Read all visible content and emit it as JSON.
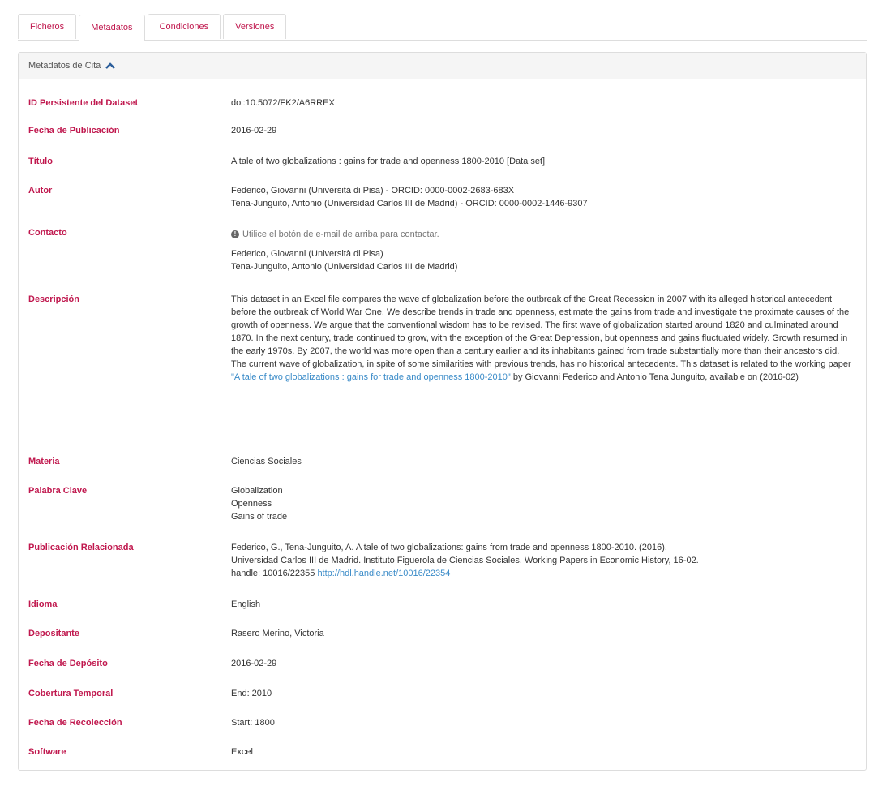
{
  "tabs": [
    {
      "label": "Ficheros"
    },
    {
      "label": "Metadatos",
      "active": true
    },
    {
      "label": "Condiciones"
    },
    {
      "label": "Versiones"
    }
  ],
  "panel": {
    "title": "Metadatos de Cita"
  },
  "fields": {
    "persistent_id": {
      "label": "ID Persistente del Dataset",
      "value": "doi:10.5072/FK2/A6RREX"
    },
    "pub_date": {
      "label": "Fecha de Publicación",
      "value": "2016-02-29"
    },
    "title": {
      "label": "Título",
      "value": "A tale of two globalizations : gains for trade and openness 1800-2010 [Data set]"
    },
    "author": {
      "label": "Autor",
      "lines": [
        "Federico, Giovanni (Università di Pisa) - ORCID: 0000-0002-2683-683X",
        "Tena-Junguito, Antonio (Universidad Carlos III de Madrid) - ORCID: 0000-0002-1446-9307"
      ]
    },
    "contact": {
      "label": "Contacto",
      "info": "Utilice el botón de e-mail de arriba para contactar.",
      "lines": [
        "Federico, Giovanni (Università di Pisa)",
        "Tena-Junguito, Antonio (Universidad Carlos III de Madrid)"
      ]
    },
    "description": {
      "label": "Descripción",
      "text": "This dataset in an Excel file compares the wave of globalization before the outbreak of the Great Recession in 2007 with its alleged historical antecedent before the outbreak of World War One. We describe trends in trade and openness, estimate the gains from trade and investigate the proximate causes of the growth of openness. We argue that the conventional wisdom has to be revised. The first wave of globalization started around 1820 and culminated around 1870. In the next century, trade continued to grow, with the exception of the Great Depression, but openness and gains fluctuated widely. Growth resumed in the early 1970s. By 2007, the world was more open than a century earlier and its inhabitants gained from trade substantially more than their ancestors did. The current wave of globalization, in spite of some similarities with previous trends, has no historical antecedents. This dataset is related to the working paper ",
      "link": "\"A tale of two globalizations : gains for trade and openness 1800-2010\"",
      "text_after": " by Giovanni Federico and Antonio Tena Junguito, available on (2016-02)"
    },
    "subject": {
      "label": "Materia",
      "value": "Ciencias Sociales"
    },
    "keyword": {
      "label": "Palabra Clave",
      "lines": [
        "Globalization",
        "Openness",
        "Gains of trade"
      ]
    },
    "related_pub": {
      "label": "Publicación Relacionada",
      "line1": "Federico, G., Tena-Junguito, A. A tale of two globalizations: gains from trade and openness 1800-2010. (2016).",
      "line2": "Universidad Carlos III de Madrid. Instituto Figuerola de Ciencias Sociales. Working Papers in Economic History, 16-02.",
      "line3": "handle: 10016/22355 ",
      "link": "http://hdl.handle.net/10016/22354"
    },
    "language": {
      "label": "Idioma",
      "value": "English"
    },
    "depositor": {
      "label": "Depositante",
      "value": "Rasero Merino, Victoria"
    },
    "deposit_date": {
      "label": "Fecha de Depósito",
      "value": "2016-02-29"
    },
    "time_coverage": {
      "label": "Cobertura Temporal",
      "value": "End: 2010"
    },
    "collection_date": {
      "label": "Fecha de Recolección",
      "value": "Start: 1800"
    },
    "software": {
      "label": "Software",
      "value": "Excel"
    }
  },
  "colors": {
    "label": "#c0184e",
    "link": "#3a8bc8",
    "border": "#dddddd"
  },
  "icons": {
    "collapse": "chevron-up-icon",
    "info": "info-circle-icon"
  }
}
